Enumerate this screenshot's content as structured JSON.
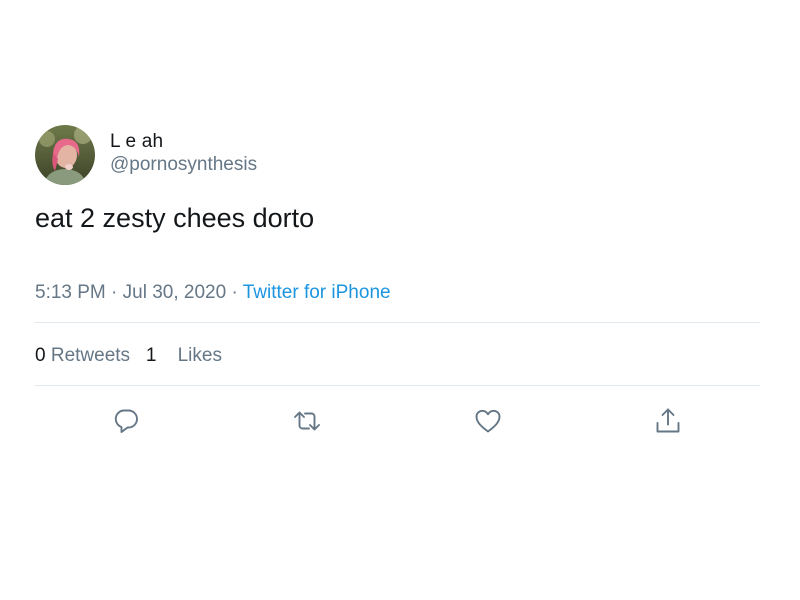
{
  "author": {
    "display_name": "L e ah",
    "handle": "@pornosynthesis"
  },
  "tweet": {
    "text": "eat 2 zesty chees dorto",
    "time": "5:13 PM",
    "separator": " · ",
    "date": "Jul 30, 2020",
    "source": "Twitter for iPhone"
  },
  "stats": {
    "retweets_count": "0",
    "retweets_label": "Retweets",
    "likes_count": "1",
    "likes_label": "Likes"
  },
  "actions": [
    {
      "icon": "reply-icon"
    },
    {
      "icon": "retweet-icon"
    },
    {
      "icon": "like-icon"
    },
    {
      "icon": "share-icon"
    }
  ],
  "colors": {
    "text_primary": "#14171a",
    "text_secondary": "#657786",
    "link": "#1b95e0",
    "divider": "#e1e8ed"
  }
}
